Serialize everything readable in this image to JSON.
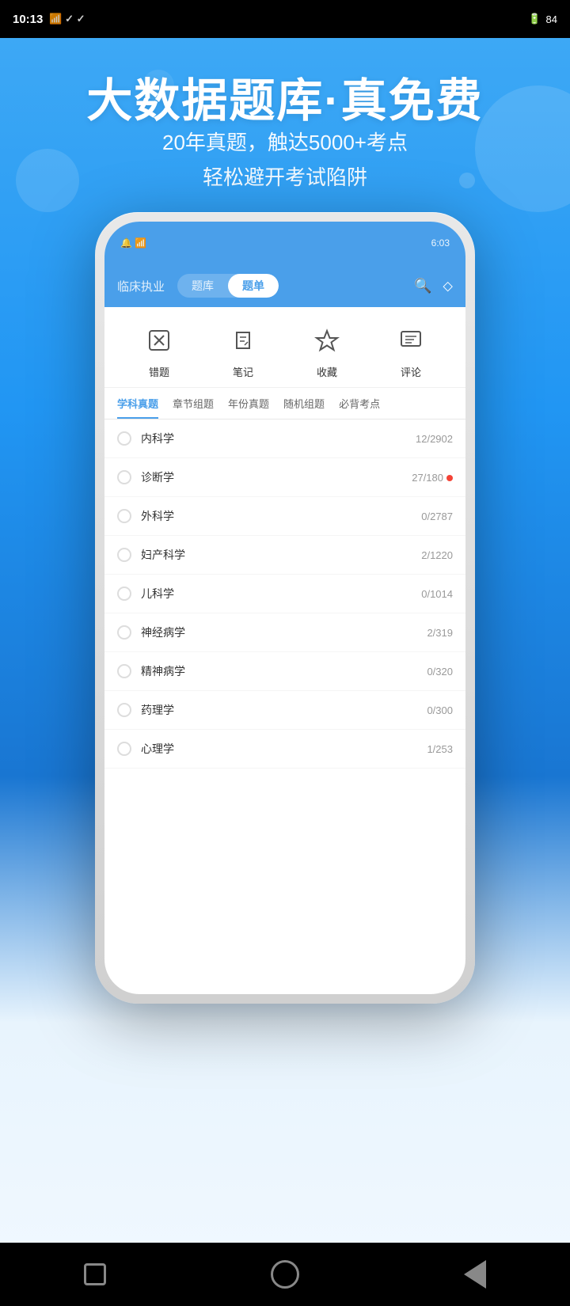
{
  "statusBar": {
    "time": "10:13",
    "battery": "84"
  },
  "hero": {
    "title": "大数据题库·真免费",
    "subtitle_line1": "20年真题，触达5000+考点",
    "subtitle_line2": "轻松避开考试陷阱"
  },
  "phone": {
    "status": {
      "time": "6:03"
    },
    "appTitle": "临床执业",
    "tabs": [
      {
        "label": "题库",
        "active": false
      },
      {
        "label": "题单",
        "active": true
      }
    ],
    "quickActions": [
      {
        "label": "错题",
        "icon": "✕"
      },
      {
        "label": "笔记",
        "icon": "✏"
      },
      {
        "label": "收藏",
        "icon": "☆"
      },
      {
        "label": "评论",
        "icon": "▤"
      }
    ],
    "subjectTabs": [
      {
        "label": "学科真题",
        "active": true
      },
      {
        "label": "章节组题",
        "active": false
      },
      {
        "label": "年份真题",
        "active": false
      },
      {
        "label": "随机组题",
        "active": false
      },
      {
        "label": "必背考点",
        "active": false
      }
    ],
    "subjects": [
      {
        "name": "内科学",
        "progress": "12/2902",
        "hasDot": false,
        "hasRedDot": false
      },
      {
        "name": "诊断学",
        "progress": "27/180",
        "hasDot": false,
        "hasRedDot": true
      },
      {
        "name": "外科学",
        "progress": "0/2787",
        "hasDot": false,
        "hasRedDot": false
      },
      {
        "name": "妇产科学",
        "progress": "2/1220",
        "hasDot": false,
        "hasRedDot": false
      },
      {
        "name": "儿科学",
        "progress": "0/1014",
        "hasDot": false,
        "hasRedDot": false
      },
      {
        "name": "神经病学",
        "progress": "2/319",
        "hasDot": false,
        "hasRedDot": false
      },
      {
        "name": "精神病学",
        "progress": "0/320",
        "hasDot": false,
        "hasRedDot": false
      },
      {
        "name": "药理学",
        "progress": "0/300",
        "hasDot": false,
        "hasRedDot": false
      },
      {
        "name": "心理学",
        "progress": "1/253",
        "hasDot": false,
        "hasRedDot": false
      }
    ]
  }
}
